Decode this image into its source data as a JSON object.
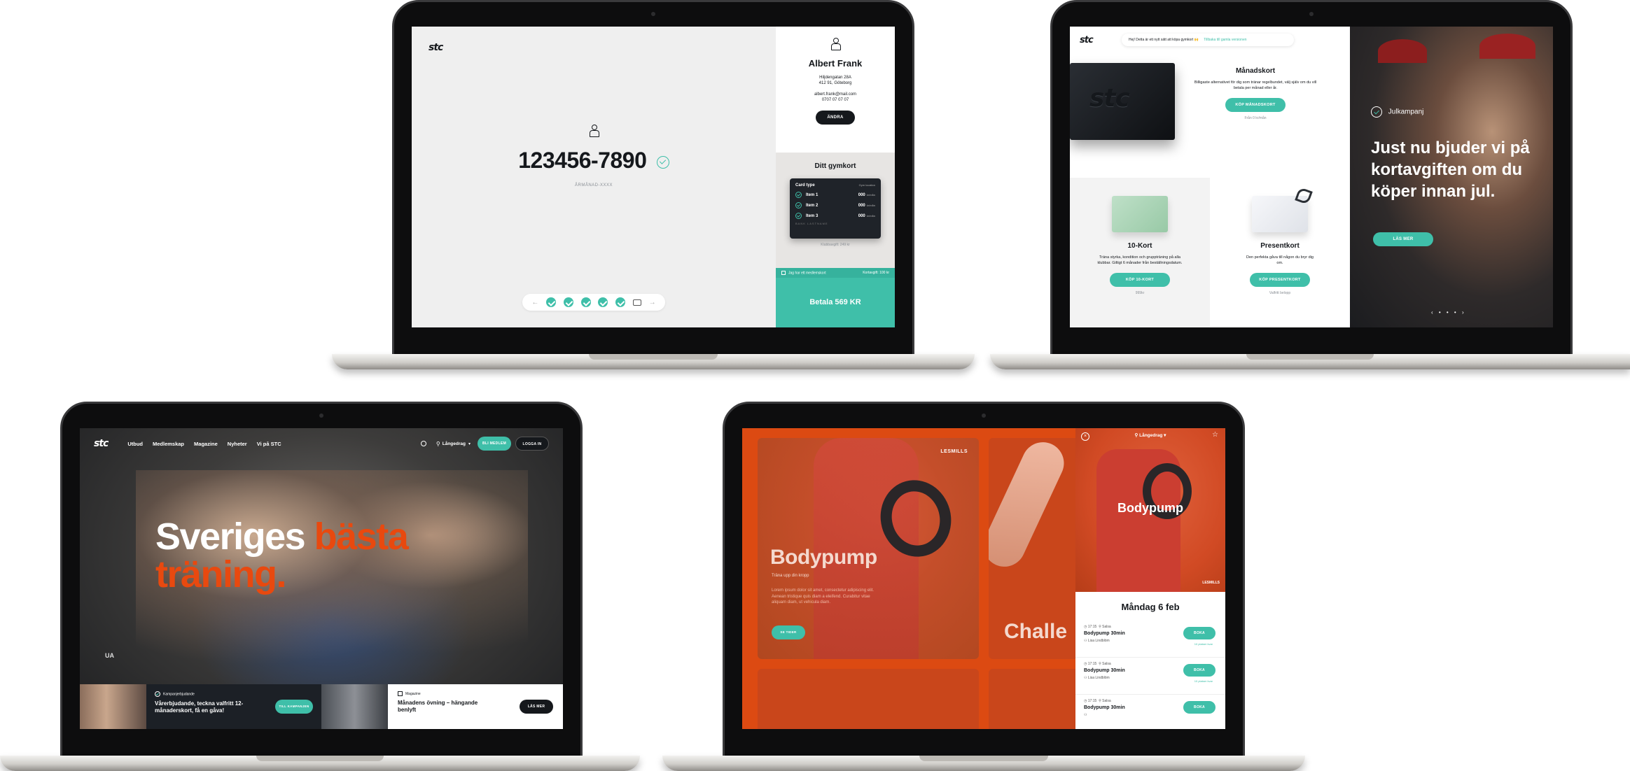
{
  "s1": {
    "logo": "stc",
    "person_number": "123456-7890",
    "person_number_caption": "ÅRMÅNAD-XXXX",
    "profile": {
      "name": "Albert Frank",
      "street": "Hiljdengatan 28A",
      "city": "412 91, Göteborg",
      "email": "albert.frank@mail.com",
      "phone": "0707 07 07 07",
      "edit_label": "ÄNDRA"
    },
    "card_section_title": "Ditt gymkort",
    "card": {
      "type_label": "Card type",
      "location_label": "Gym location",
      "items": [
        {
          "name": "Item 1",
          "price": "000",
          "unit": "kr/mån"
        },
        {
          "name": "Item 2",
          "price": "000",
          "unit": "kr/mån"
        },
        {
          "name": "Item 3",
          "price": "000",
          "unit": "kr/mån"
        }
      ],
      "footer": "BANK LASTNAME"
    },
    "card_fee": "Klubbavgift: 249 kr",
    "member_label": "Jag har ett medlemskort",
    "card_fee2": "Kortavgift: 100 kr",
    "pay_label": "Betala 569 KR",
    "steps": 5
  },
  "s2": {
    "logo": "stc",
    "notice": "Hej! Detta är ett nytt sätt att köpa gymkort 🙌",
    "notice_link": "Tillbaka till gamla versionen",
    "monthly": {
      "title": "Månadskort",
      "desc": "Billigaste alternativet för dig som tränar regelbundet, välj själv om du vill betala per månad eller år.",
      "btn": "KÖP MÅNADSKORT",
      "sub": "Från 0 kr/mån"
    },
    "ten": {
      "title": "10-Kort",
      "desc": "Träna styrka, kondition och gruppträning på alla klubbar. Giltigt 6 månader från beställningsdatum.",
      "btn": "KÖP 10-KORT",
      "sub": "999kr"
    },
    "gift": {
      "title": "Presentkort",
      "desc": "Den perfekta gåva till någon du bryr dig om.",
      "btn": "KÖP PRESENTKORT",
      "sub": "Valfritt belopp"
    },
    "hero": {
      "tag": "Julkampanj",
      "headline": "Just nu bjuder vi på kortavgiften om du köper innan jul.",
      "btn": "LÄS MER"
    },
    "card_brand": "stc"
  },
  "s3": {
    "logo": "stc",
    "nav": [
      "Utbud",
      "Medlemskap",
      "Magazine",
      "Nyheter",
      "Vi på STC"
    ],
    "location": "Långedrag",
    "become_member": "BLI MEDLEM",
    "login": "LOGGA IN",
    "hero_white": "Sveriges ",
    "hero_orange1": "bästa",
    "hero_orange2": "träning.",
    "promo": {
      "tag": "Kampanjerbjudande",
      "text": "Vårerbjudande, teckna valfritt 12-månaderskort, få en gåva!",
      "btn": "TILL KAMPANJEN"
    },
    "magazine": {
      "tag": "Magazine",
      "text": "Månadens övning – hängande benlyft",
      "btn": "LÄS MER"
    },
    "ua": "UA"
  },
  "s4": {
    "left_card": {
      "brand": "LESMILLS",
      "title": "Bodypump",
      "subtitle": "Träna upp din kropp",
      "desc": "Lorem ipsum dolor sit amet, consectetur adipiscing elit. Aenean tristique quis diam a eleifend. Curabitur vitae aliquam diam, ut vehicula diam.",
      "btn": "SE TIDER"
    },
    "second_card_title": "Challe",
    "panel": {
      "location": "Långedrag",
      "title": "Bodypump",
      "brand": "LESMILLS",
      "date": "Måndag 6 feb",
      "classes": [
        {
          "time": "17:15",
          "room": "Salsa",
          "name": "Bodypump 30min",
          "instructor": "Lisa Lindblöm",
          "btn": "BOKA",
          "spots": "10 platser kvar"
        },
        {
          "time": "17:15",
          "room": "Salsa",
          "name": "Bodypump 30min",
          "instructor": "Lisa Lindblöm",
          "btn": "BOKA",
          "spots": "10 platser kvar"
        },
        {
          "time": "17:15",
          "room": "Salsa",
          "name": "Bodypump 30min",
          "instructor": "",
          "btn": "BOKA",
          "spots": ""
        }
      ]
    }
  },
  "colors": {
    "teal": "#3fbfa9",
    "orange": "#e8490f",
    "dark": "#15181c"
  }
}
